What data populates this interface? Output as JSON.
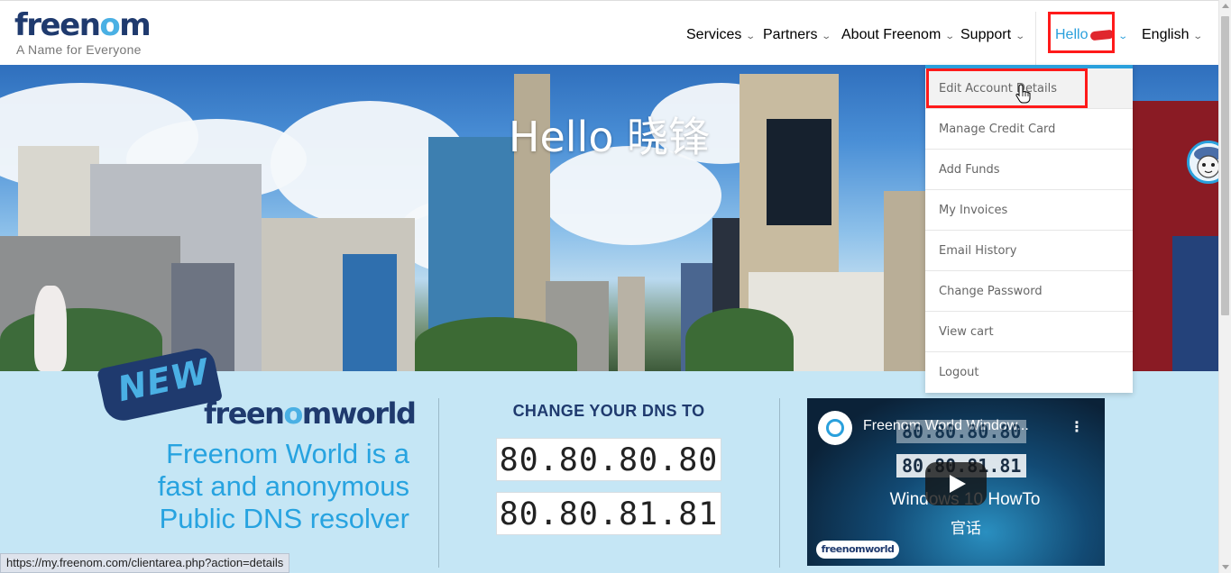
{
  "brand": {
    "logo_part1": "free",
    "logo_part2": "n",
    "logo_part3": "o",
    "logo_part4": "m",
    "tagline": "A Name for Everyone"
  },
  "nav": {
    "services": "Services",
    "partners": "Partners",
    "about": "About Freenom",
    "support": "Support",
    "hello": "Hello",
    "language": "English"
  },
  "hero": {
    "title": "Hello 晓锋"
  },
  "account_menu": {
    "items": [
      "Edit Account Details",
      "Manage Credit Card",
      "Add Funds",
      "My Invoices",
      "Email History",
      "Change Password",
      "View cart",
      "Logout"
    ]
  },
  "promo": {
    "badge": "NEW",
    "logo_a": "free",
    "logo_b": "n",
    "logo_c": "o",
    "logo_d": "mworld",
    "line1": "Freenom World is a",
    "line2": "fast and anonymous",
    "line3": "Public DNS resolver"
  },
  "dns": {
    "title": "CHANGE YOUR DNS TO",
    "primary": "80.80.80.80",
    "secondary": "80.80.81.81"
  },
  "video": {
    "title": "Freenom World Window...",
    "ip1": "80.80.80.80",
    "ip2": "80.80.81.81",
    "caption1": "Windows 10 HowTo",
    "caption2": "官话",
    "logo": "freenomworld"
  },
  "statusbar": {
    "url": "https://my.freenom.com/clientarea.php?action=details"
  },
  "colors": {
    "accent": "#2aa0dc",
    "brand_dark": "#1f3a6e",
    "highlight": "#ff1a1a",
    "banner_bg": "#c5e6f5"
  }
}
